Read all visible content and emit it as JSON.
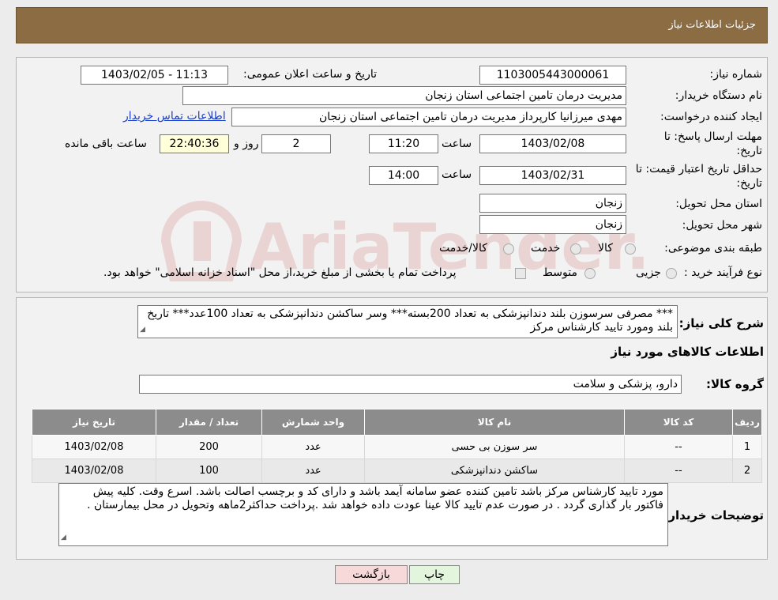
{
  "header": {
    "title": "جزئیات اطلاعات نیاز"
  },
  "form": {
    "need_number": {
      "label": "شماره نیاز:",
      "value": "1103005443000061"
    },
    "announce_datetime": {
      "label": "تاریخ و ساعت اعلان عمومی:",
      "value": "1403/02/05 - 11:13"
    },
    "buyer_org": {
      "label": "نام دستگاه خریدار:",
      "value": "مدیریت درمان تامین اجتماعی استان زنجان"
    },
    "requester": {
      "label": "ایجاد کننده درخواست:",
      "value": "مهدی میرزانیا کارپرداز مدیریت درمان تامین اجتماعی استان زنجان",
      "contact_link": "اطلاعات تماس خریدار"
    },
    "response_deadline": {
      "label_line1": "مهلت ارسال پاسخ: تا",
      "label_line2": "تاریخ:",
      "date": "1403/02/08",
      "time_label": "ساعت",
      "time": "11:20",
      "days": "2",
      "days_label": "روز و",
      "remaining": "22:40:36",
      "remaining_label": "ساعت باقی مانده"
    },
    "price_validity": {
      "label_line1": "حداقل تاریخ اعتبار قیمت: تا",
      "label_line2": "تاریخ:",
      "date": "1403/02/31",
      "time_label": "ساعت",
      "time": "14:00"
    },
    "delivery_province": {
      "label": "استان محل تحویل:",
      "value": "زنجان"
    },
    "delivery_city": {
      "label": "شهر محل تحویل:",
      "value": "زنجان"
    },
    "category": {
      "label": "طبقه بندی موضوعی:",
      "options": [
        "کالا",
        "خدمت",
        "کالا/خدمت"
      ]
    },
    "purchase_process": {
      "label": "نوع فرآیند خرید :",
      "options": [
        "جزیی",
        "متوسط"
      ],
      "note": "پرداخت تمام یا بخشی از مبلغ خرید،از محل \"اسناد خزانه اسلامی\" خواهد بود."
    }
  },
  "description": {
    "label": "شرح کلی نیاز:",
    "text": "*** مصرفی سرسوزن بلند دندانپزشکی به تعداد 200بسته*** وسر ساکشن دندانپزشکی به تعداد 100عدد*** تاریخ بلند ومورد تایید کارشناس مرکز"
  },
  "goods_section_title": "اطلاعات کالاهای مورد نیاز",
  "goods_group": {
    "label": "گروه کالا:",
    "value": "دارو، پزشکی و سلامت"
  },
  "table": {
    "headers": [
      "ردیف",
      "کد کالا",
      "نام کالا",
      "واحد شمارش",
      "تعداد / مقدار",
      "تاریخ نیاز"
    ],
    "rows": [
      [
        "1",
        "--",
        "سر سوزن بی حسی",
        "عدد",
        "200",
        "1403/02/08"
      ],
      [
        "2",
        "--",
        "ساکشن دندانپزشکی",
        "عدد",
        "100",
        "1403/02/08"
      ]
    ]
  },
  "buyer_notes": {
    "label": "توضیحات خریدار:",
    "text": "مورد تایید کارشناس مرکز باشد تامین کننده عضو سامانه آیمد باشد و دارای کد  و برچسب اصالت باشد. اسرع وقت. کلیه پیش فاکتور بار گذاری گردد . در صورت عدم تایید کالا عینا عودت داده خواهد شد .پرداخت  حداکثر2ماهه وتحویل در محل بیمارستان ."
  },
  "buttons": {
    "print": "چاپ",
    "back": "بازگشت"
  },
  "watermark": "AriaTender.neT",
  "colors": {
    "header_bg": "#8b6c43",
    "table_header_bg": "#8c8c8c",
    "link": "#1a3fc9",
    "back_button_bg": "#f7d9d9",
    "print_button_bg": "#e3f5dc"
  }
}
